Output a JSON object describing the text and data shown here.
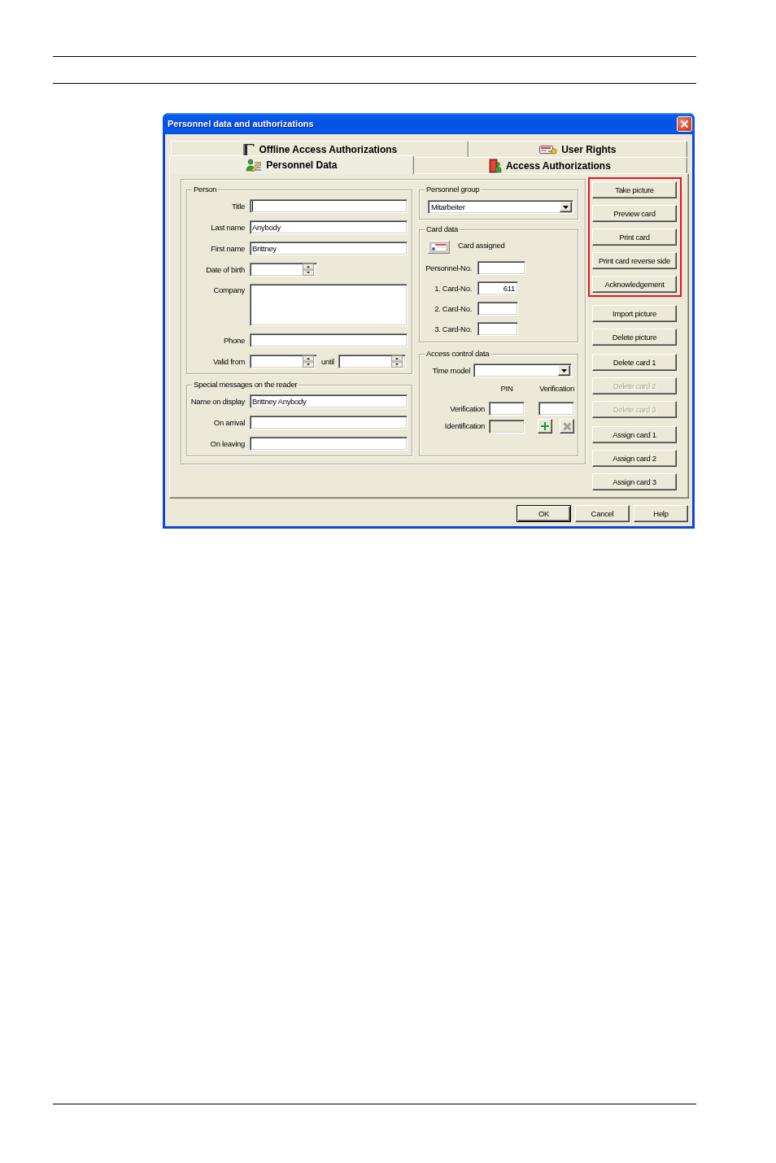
{
  "window": {
    "title": "Personnel data and authorizations"
  },
  "tabs": {
    "rows": [
      [
        {
          "label": "Offline Access Authorizations",
          "selected": false
        },
        {
          "label": "User Rights",
          "selected": false
        }
      ],
      [
        {
          "label": "Personnel Data",
          "selected": true
        },
        {
          "label": "Access Authorizations",
          "selected": false
        }
      ]
    ]
  },
  "person": {
    "label": "Person",
    "fields": [
      {
        "kind": "text",
        "label": "Title",
        "focused": true
      },
      {
        "kind": "text",
        "label": "Last name",
        "value": "Anybody",
        "focused": false
      },
      {
        "kind": "text",
        "label": "First name",
        "value": "Brittney",
        "focused": false
      },
      {
        "kind": "spin",
        "label": "Date of birth",
        "focused": false
      },
      {
        "kind": "multiline",
        "label": "Company",
        "focused": false
      },
      {
        "kind": "text",
        "label": "Phone",
        "focused": false
      },
      {
        "kind": "range",
        "label": "Valid from",
        "until_label": "until",
        "focused": false
      }
    ]
  },
  "special_messages": {
    "label": "Special messages on the reader",
    "fields": [
      {
        "label": "Name on display",
        "value": "Brittney Anybody"
      },
      {
        "label": "On arrival"
      },
      {
        "label": "On leaving"
      }
    ]
  },
  "personnel_group": {
    "label": "Personnel group",
    "value": "Mitarbeiter"
  },
  "card_data": {
    "label": "Card data",
    "status": "Card assigned",
    "fields": [
      {
        "label": "Personnel-No."
      },
      {
        "label": "1. Card-No.",
        "value": "611"
      },
      {
        "label": "2. Card-No."
      },
      {
        "label": "3. Card-No."
      }
    ]
  },
  "access_control": {
    "label": "Access control data",
    "time_model": {
      "label": "Time model"
    },
    "columns": [
      "PIN",
      "Verification"
    ],
    "rows": [
      {
        "label": "Verification",
        "fields": [
          {
            "disabled": false
          },
          {
            "disabled": false
          }
        ]
      },
      {
        "label": "Identification",
        "fields": [
          {
            "disabled": true
          }
        ],
        "buttons": [
          {
            "kind": "add",
            "disabled": false
          },
          {
            "kind": "remove",
            "disabled": true
          }
        ]
      }
    ]
  },
  "side_buttons": [
    {
      "highlighted": true,
      "buttons": [
        {
          "label": "Take picture",
          "disabled": false
        },
        {
          "label": "Preview card",
          "disabled": false
        },
        {
          "label": "Print card",
          "disabled": false
        },
        {
          "label": "Print card reverse side",
          "disabled": false
        },
        {
          "label": "Acknowledgement",
          "disabled": false
        }
      ]
    },
    {
      "highlighted": false,
      "buttons": [
        {
          "label": "Import picture",
          "disabled": false
        },
        {
          "label": "Delete picture",
          "disabled": false
        }
      ]
    },
    {
      "highlighted": false,
      "buttons": [
        {
          "label": "Delete card 1",
          "disabled": false
        },
        {
          "label": "Delete card 2",
          "disabled": true
        },
        {
          "label": "Delete card 3",
          "disabled": true
        }
      ]
    },
    {
      "highlighted": false,
      "buttons": [
        {
          "label": "Assign card 1",
          "disabled": false
        },
        {
          "label": "Assign card 2",
          "disabled": false
        },
        {
          "label": "Assign card 3",
          "disabled": false
        }
      ]
    }
  ],
  "dialog_buttons": [
    {
      "label": "OK",
      "default": true
    },
    {
      "label": "Cancel",
      "default": false
    },
    {
      "label": "Help",
      "default": false
    }
  ]
}
